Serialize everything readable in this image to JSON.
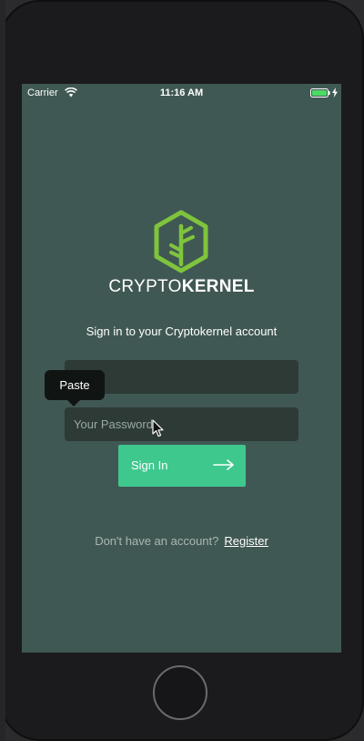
{
  "status_bar": {
    "carrier": "Carrier",
    "time": "11:16 AM",
    "battery_color": "#4cd964"
  },
  "brand": {
    "name_light": "CRYPTO",
    "name_bold": "KERNEL",
    "logo_color": "#7fc43d"
  },
  "login": {
    "subtitle": "Sign in to your Cryptokernel account",
    "username_value": "",
    "password_placeholder": "Your Password",
    "signin_label": "Sign In",
    "signin_color": "#3ec88e",
    "register_prompt": "Don't have an account?",
    "register_link": "Register"
  },
  "context_menu": {
    "paste_label": "Paste"
  },
  "icons": {
    "wifi": "wifi-icon",
    "battery": "battery-icon",
    "charging": "bolt-icon",
    "logo": "hexagon-tree-logo-icon",
    "arrow": "arrow-right-icon",
    "cursor": "mouse-cursor-icon"
  }
}
